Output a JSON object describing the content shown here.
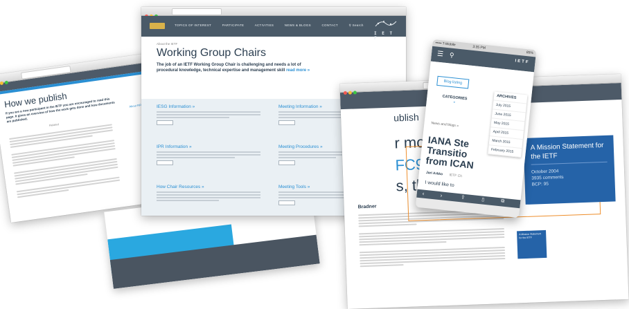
{
  "left_window": {
    "heading": "How we publish",
    "intro": "If you are a new participant in the IETF you are encouraged to read this page. It gives an overview of how the work gets done and how documents are published.",
    "subheading": "Related",
    "side_link": "About RFCs"
  },
  "main_window": {
    "nav": {
      "items": [
        "TOPICS OF INTEREST",
        "PARTICIPATE",
        "ACTIVITIES",
        "NEWS & BLOGS",
        "CONTACT"
      ],
      "search_label": "Search"
    },
    "breadcrumb": "About the IETF",
    "title": "Working Group Chairs",
    "lede": "The job of an IETF Working Group Chair is challenging and needs a lot of procedural knowledge, technical expertise and management skill",
    "read_more": "read more »",
    "cards": [
      {
        "heading": "IESG Information »",
        "button": "Go to section"
      },
      {
        "heading": "Meeting Information »",
        "button": "Go to section"
      },
      {
        "heading": "IPR Information »",
        "button": "Go to section"
      },
      {
        "heading": "Meeting Procedures »",
        "button": "Go to section"
      },
      {
        "heading": "How Chair Resources »",
        "button": "Go to section"
      },
      {
        "heading": "Meeting Tools »",
        "button": "Go to section"
      }
    ]
  },
  "right_window": {
    "partial_heading": "ublish",
    "partial_big_1": "r more",
    "partial_rfc": "FC98",
    "partial_big_2": "s, the Inter",
    "section": "Bradner",
    "callout": {
      "title": "A Mission Statement for the IETF",
      "date": "October 2004",
      "comments": "3935 comments",
      "bcp": "BCP: 95"
    },
    "mini_callout": "A Mission Statement for the IETF"
  },
  "phone": {
    "carrier": "••••• T-Mobile",
    "time": "3:35 PM",
    "battery": "85%",
    "blog_button": "Blog listing",
    "categories_label": "CATEGORIES",
    "archives": {
      "header": "ARCHIVES",
      "months": [
        "July 2015",
        "June 2015",
        "May 2015",
        "April 2015",
        "March 2015",
        "February 2015"
      ]
    },
    "news_label": "News and blogs »",
    "post_title_lines": [
      "IANA Ste",
      "Transitio",
      "from ICAN"
    ],
    "author": "Jari Arkko",
    "author_role": "IETF Ch",
    "excerpt": "I would like to"
  }
}
